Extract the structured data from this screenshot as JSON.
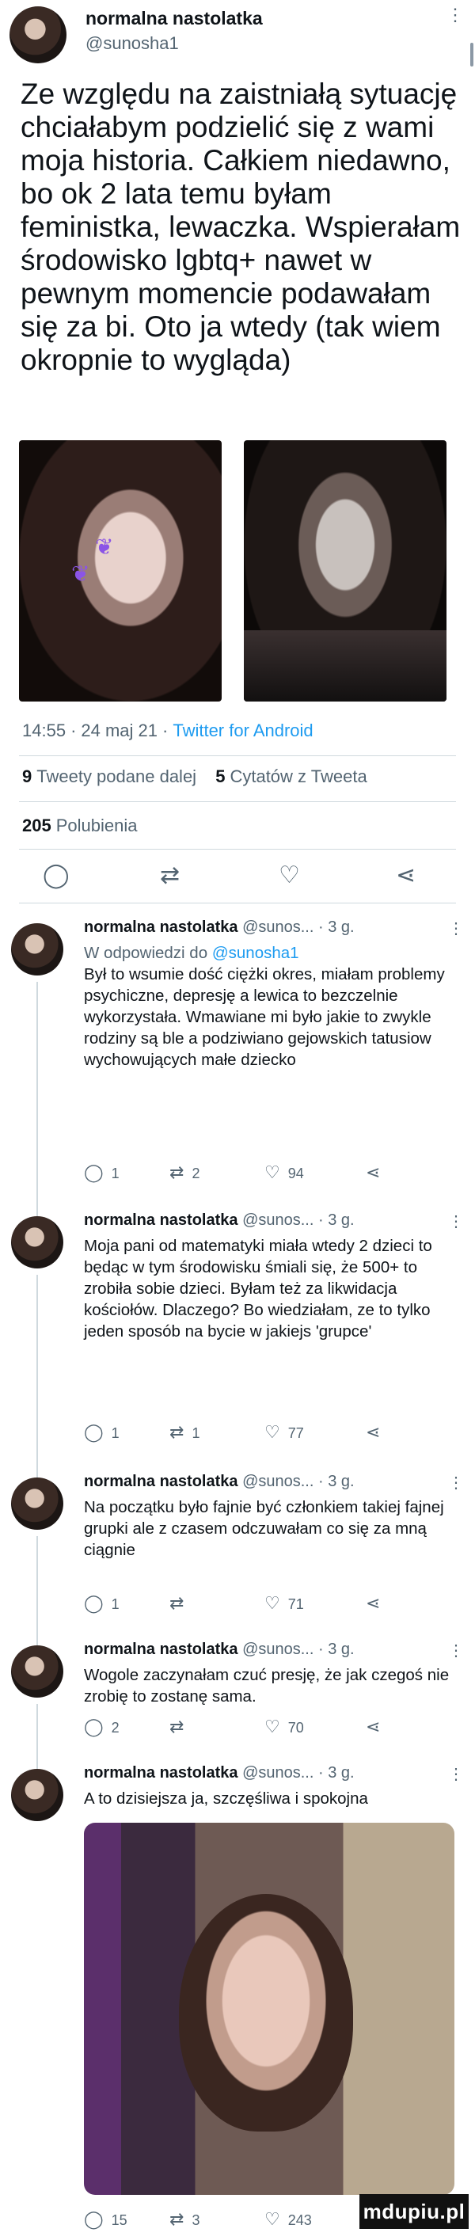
{
  "header": {
    "name": "normalna nastolatka",
    "handle": "@sunosha1",
    "more_icon": "more-vertical-icon"
  },
  "tweet": {
    "text": "Ze względu na zaistniałą sytuację chciałabym podzielić się z wami moja historia. Całkiem niedawno, bo ok 2 lata temu byłam feministka, lewaczka. Wspierałam środowisko lgbtq+ nawet w pewnym momencie podawałam się za bi. Oto ja wtedy (tak wiem okropnie to wygląda)",
    "time": "14:55",
    "date": "24 maj 21",
    "source": "Twitter for Android",
    "retweets_count": "9",
    "retweets_label": "Tweety podane dalej",
    "quotes_count": "5",
    "quotes_label": "Cytatów z Tweeta",
    "likes_count": "205",
    "likes_label": "Polubienia",
    "media_icons": [
      "butterfly-icon",
      "butterfly-icon"
    ]
  },
  "actions": [
    "reply-icon",
    "retweet-icon",
    "like-icon",
    "share-icon"
  ],
  "replies": [
    {
      "name": "normalna nastolatka",
      "handle": "@sunos...",
      "time": "3 g.",
      "reply_to_prefix": "W odpowiedzi do",
      "reply_to_handle": "@sunosha1",
      "text": "Był to wsumie dość ciężki okres, miałam problemy psychiczne, depresję a lewica to bezczelnie wykorzystała. Wmawiane mi było jakie to zwykle rodziny są ble a podziwiano gejowskich tatusiow wychowujących małe dziecko",
      "replies": "1",
      "retweets": "2",
      "likes": "94"
    },
    {
      "name": "normalna nastolatka",
      "handle": "@sunos...",
      "time": "3 g.",
      "text": "Moja pani od matematyki miała wtedy 2 dzieci to będąc w tym środowisku śmiali się, że 500+ to zrobiła sobie dzieci. Byłam też za likwidacja kościołów. Dlaczego? Bo wiedziałam, ze to tylko jeden sposób na bycie w jakiejs 'grupce'",
      "replies": "1",
      "retweets": "1",
      "likes": "77"
    },
    {
      "name": "normalna nastolatka",
      "handle": "@sunos...",
      "time": "3 g.",
      "text": "Na początku było fajnie być członkiem takiej fajnej grupki ale z czasem odczuwałam co się za mną ciągnie",
      "replies": "1",
      "retweets": "",
      "likes": "71"
    },
    {
      "name": "normalna nastolatka",
      "handle": "@sunos...",
      "time": "3 g.",
      "text": "Wogole zaczynałam czuć presję, że jak czegoś nie zrobię to zostanę sama.",
      "replies": "2",
      "retweets": "",
      "likes": "70"
    },
    {
      "name": "normalna nastolatka",
      "handle": "@sunos...",
      "time": "3 g.",
      "text": "A to dzisiejsza ja, szczęśliwa i spokojna",
      "replies": "15",
      "retweets": "3",
      "likes": "243"
    }
  ],
  "watermark": "mdupiu.pl"
}
